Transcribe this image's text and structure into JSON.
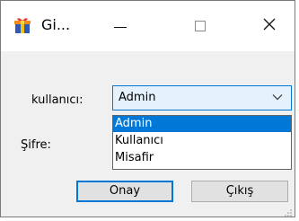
{
  "window": {
    "title": "Gi...",
    "icon": "app-gift-icon",
    "controls": {
      "minimize": "minimize-icon",
      "maximize": "maximize-icon",
      "close": "close-icon"
    }
  },
  "form": {
    "user_label": "kullanıcı:",
    "password_label": "Şifre:",
    "user_combo": {
      "value": "Admin",
      "options": [
        "Admin",
        "Kullanıcı",
        "Misafir"
      ],
      "highlighted": "Admin"
    }
  },
  "buttons": {
    "ok_label": "Onay",
    "exit_label": "Çıkış"
  },
  "colors": {
    "accent": "#0078d7",
    "window_bg": "#f0f0f0",
    "titlebar_bg": "#ffffff"
  }
}
